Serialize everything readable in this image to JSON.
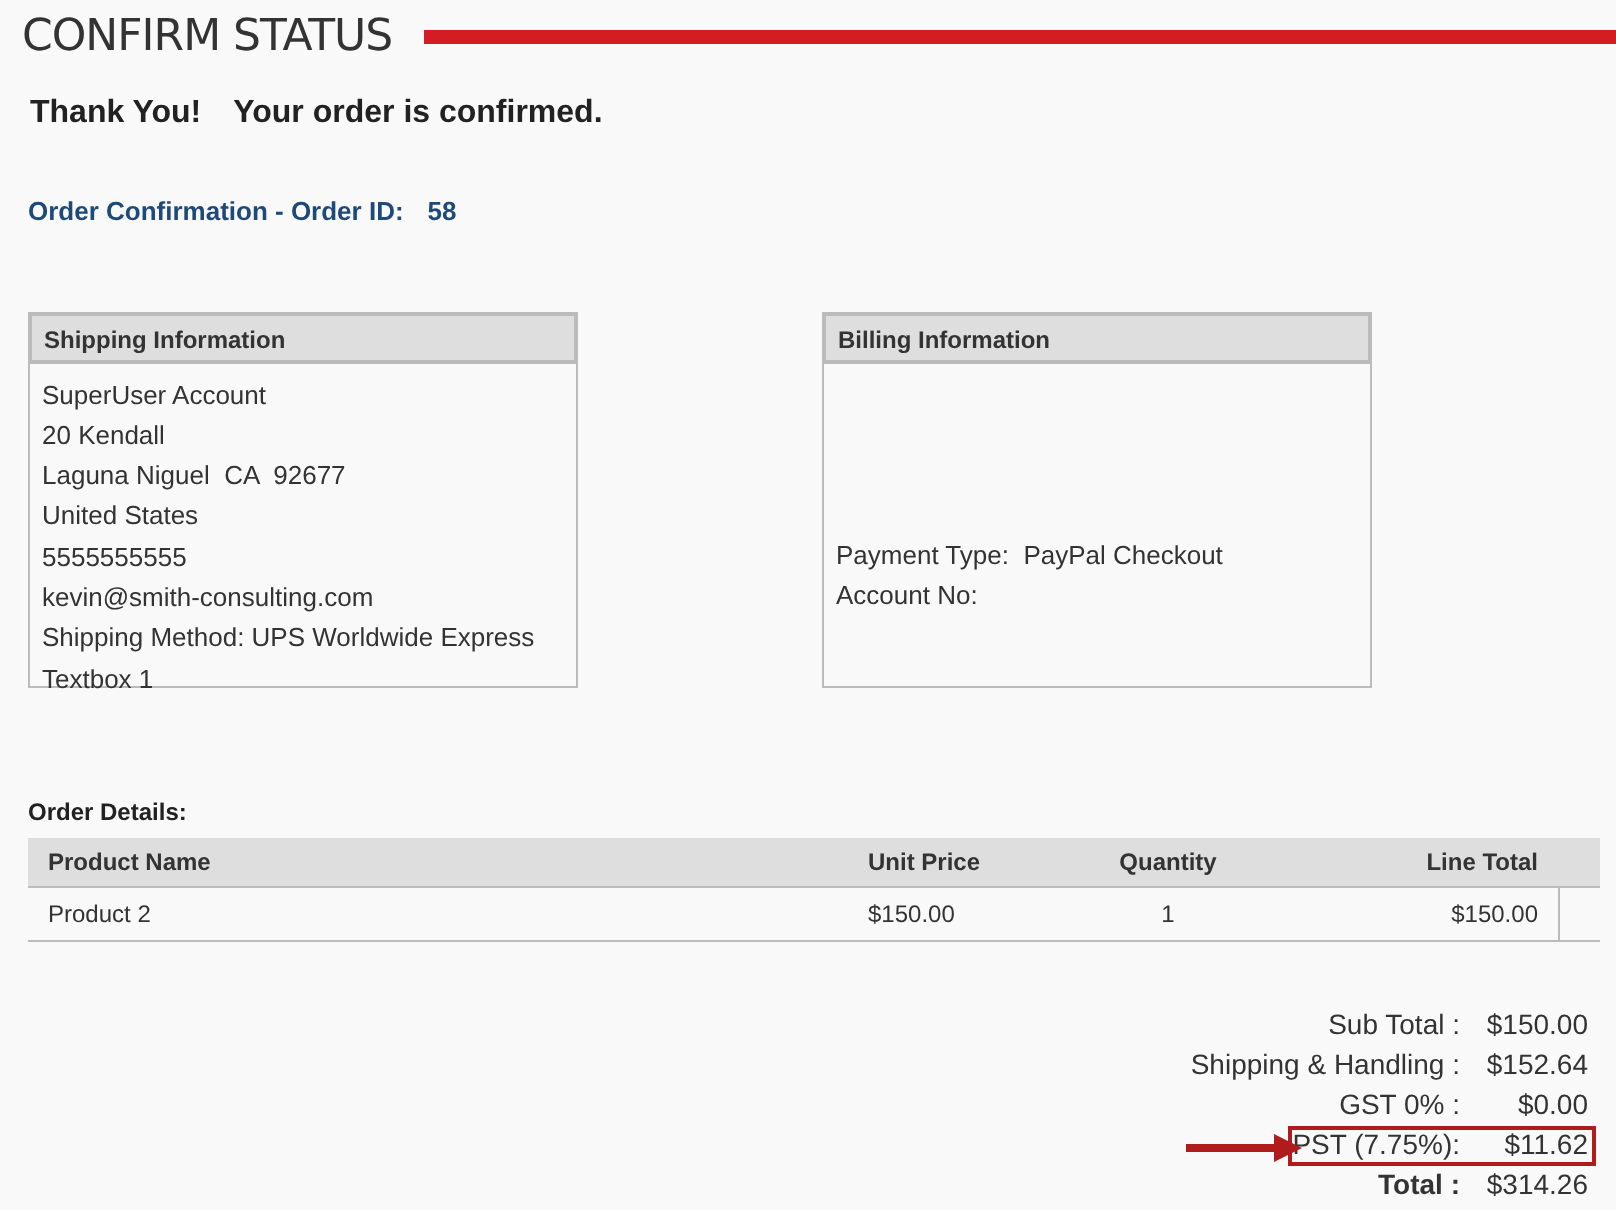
{
  "title": "CONFIRM STATUS",
  "thank_you": "Thank You!",
  "confirmed": "Your order is confirmed.",
  "order_confirmation": {
    "label": "Order Confirmation - Order ID:",
    "order_id": "58"
  },
  "shipping": {
    "title": "Shipping Information",
    "lines": [
      "SuperUser Account",
      "20 Kendall",
      "Laguna Niguel  CA  92677",
      "United States",
      "5555555555",
      "kevin@smith-consulting.com",
      "Shipping Method: UPS Worldwide Express",
      "Textbox 1"
    ]
  },
  "billing": {
    "title": "Billing Information",
    "lines": [
      "Payment Type:  PayPal Checkout",
      "Account No:"
    ]
  },
  "order_details": {
    "label": "Order Details:",
    "columns": [
      "Product Name",
      "Unit Price",
      "Quantity",
      "Line Total"
    ],
    "rows": [
      [
        "Product 2",
        "$150.00",
        "1",
        "$150.00"
      ]
    ]
  },
  "totals": [
    {
      "label": "Sub Total :",
      "value": "$150.00",
      "kind": "normal",
      "highlighted": false
    },
    {
      "label": "Shipping & Handling :",
      "value": "$152.64",
      "kind": "normal",
      "highlighted": false
    },
    {
      "label": "GST 0% :",
      "value": "$0.00",
      "kind": "normal",
      "highlighted": false
    },
    {
      "label": "PST (7.75%):",
      "value": "$11.62",
      "kind": "normal",
      "highlighted": true
    },
    {
      "label": "Total :",
      "value": "$314.26",
      "kind": "total",
      "highlighted": false
    }
  ]
}
